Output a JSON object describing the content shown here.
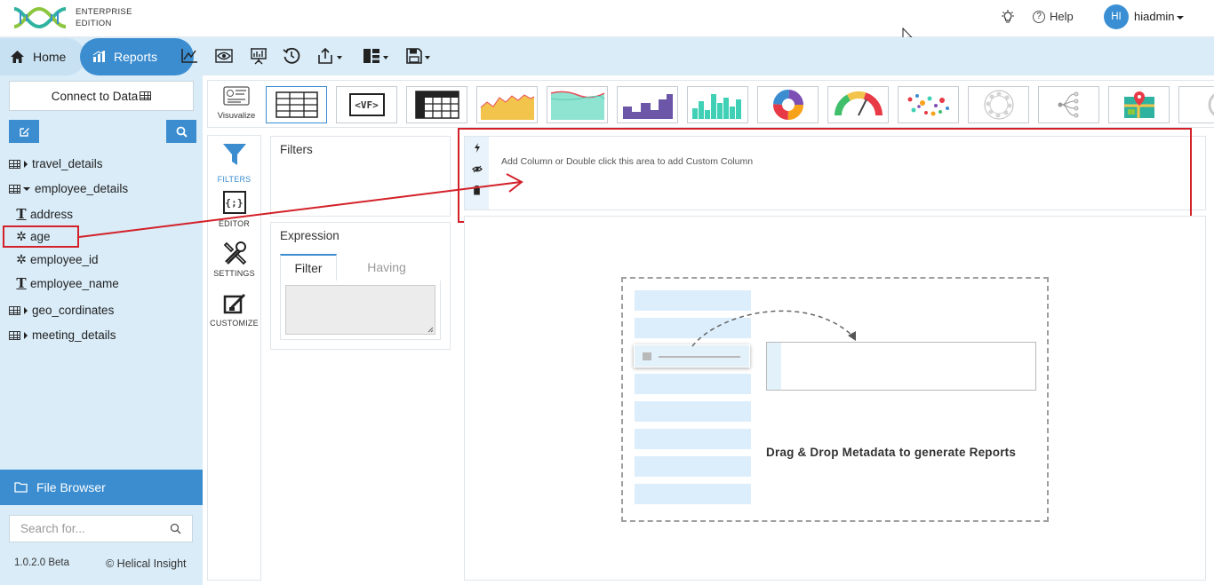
{
  "app": {
    "edition_line1": "ENTERPRISE",
    "edition_line2": "EDITION",
    "help_label": "Help",
    "avatar_initials": "HI",
    "username": "hiadmin",
    "brand_color": "#3b8dd0"
  },
  "nav": {
    "home_label": "Home",
    "reports_label": "Reports",
    "toolbar_icons": [
      "line-chart-icon",
      "eye-icon",
      "presentation-icon",
      "history-icon",
      "share-icon",
      "layout-icon",
      "save-icon"
    ]
  },
  "sidebar": {
    "connect_label": "Connect to Data",
    "tables": [
      {
        "name": "travel_details",
        "expanded": false
      },
      {
        "name": "employee_details",
        "expanded": true
      },
      {
        "name": "geo_cordinates",
        "expanded": false
      },
      {
        "name": "meeting_details",
        "expanded": false
      }
    ],
    "fields": [
      {
        "name": "address",
        "type": "text"
      },
      {
        "name": "age",
        "type": "numeric"
      },
      {
        "name": "employee_id",
        "type": "numeric"
      },
      {
        "name": "employee_name",
        "type": "text"
      }
    ],
    "file_browser_label": "File Browser",
    "search_placeholder": "Search for...",
    "version": "1.0.2.0 Beta",
    "copyright": "© Helical Insight"
  },
  "chart_bar": {
    "visualize_label": "Visuvalize",
    "vf_label": "<VF>",
    "thumbnails": [
      "table-icon",
      "vf-icon",
      "crosstab-icon",
      "area-chart-icon",
      "stacked-area-icon",
      "step-chart-icon",
      "bar-chart-icon",
      "donut-chart-icon",
      "gauge-chart-icon",
      "scatter-chart-icon",
      "radial-chart-icon",
      "tree-chart-icon",
      "map-chart-icon",
      "partial-chart-icon"
    ]
  },
  "side_tabs": {
    "filters": "FILTERS",
    "editor": "EDITOR",
    "settings": "SETTINGS",
    "customize": "CUSTOMIZE"
  },
  "filters_panel": {
    "title": "Filters"
  },
  "expression_panel": {
    "title": "Expression",
    "tab_filter": "Filter",
    "tab_having": "Having"
  },
  "columns_zone": {
    "hint": "Add Column or Double click this area to add Custom Column"
  },
  "canvas": {
    "drag_drop_text": "Drag & Drop Metadata to generate Reports"
  }
}
